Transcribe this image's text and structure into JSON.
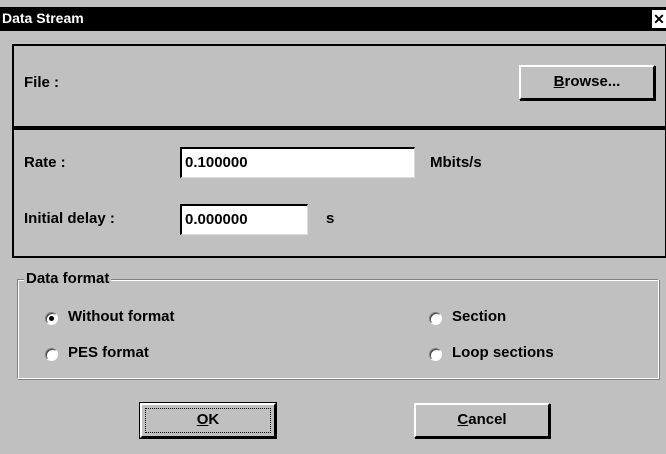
{
  "window": {
    "title": "Data Stream",
    "close_glyph": "✕"
  },
  "file_section": {
    "label": "File :",
    "browse_prefix": "",
    "browse_underlined": "B",
    "browse_rest": "rowse..."
  },
  "rate_section": {
    "rate_label": "Rate :",
    "rate_value": "0.100000",
    "rate_unit": "Mbits/s",
    "delay_label": "Initial delay :",
    "delay_value": "0.000000",
    "delay_unit": "s"
  },
  "data_format": {
    "legend": "Data format",
    "options": [
      {
        "label": "Without format",
        "checked": true
      },
      {
        "label": "PES format",
        "checked": false
      },
      {
        "label": "Section",
        "checked": false
      },
      {
        "label": "Loop sections",
        "checked": false
      }
    ]
  },
  "buttons": {
    "ok_underlined": "O",
    "ok_rest": "K",
    "cancel_underlined": "C",
    "cancel_rest": "ancel"
  }
}
